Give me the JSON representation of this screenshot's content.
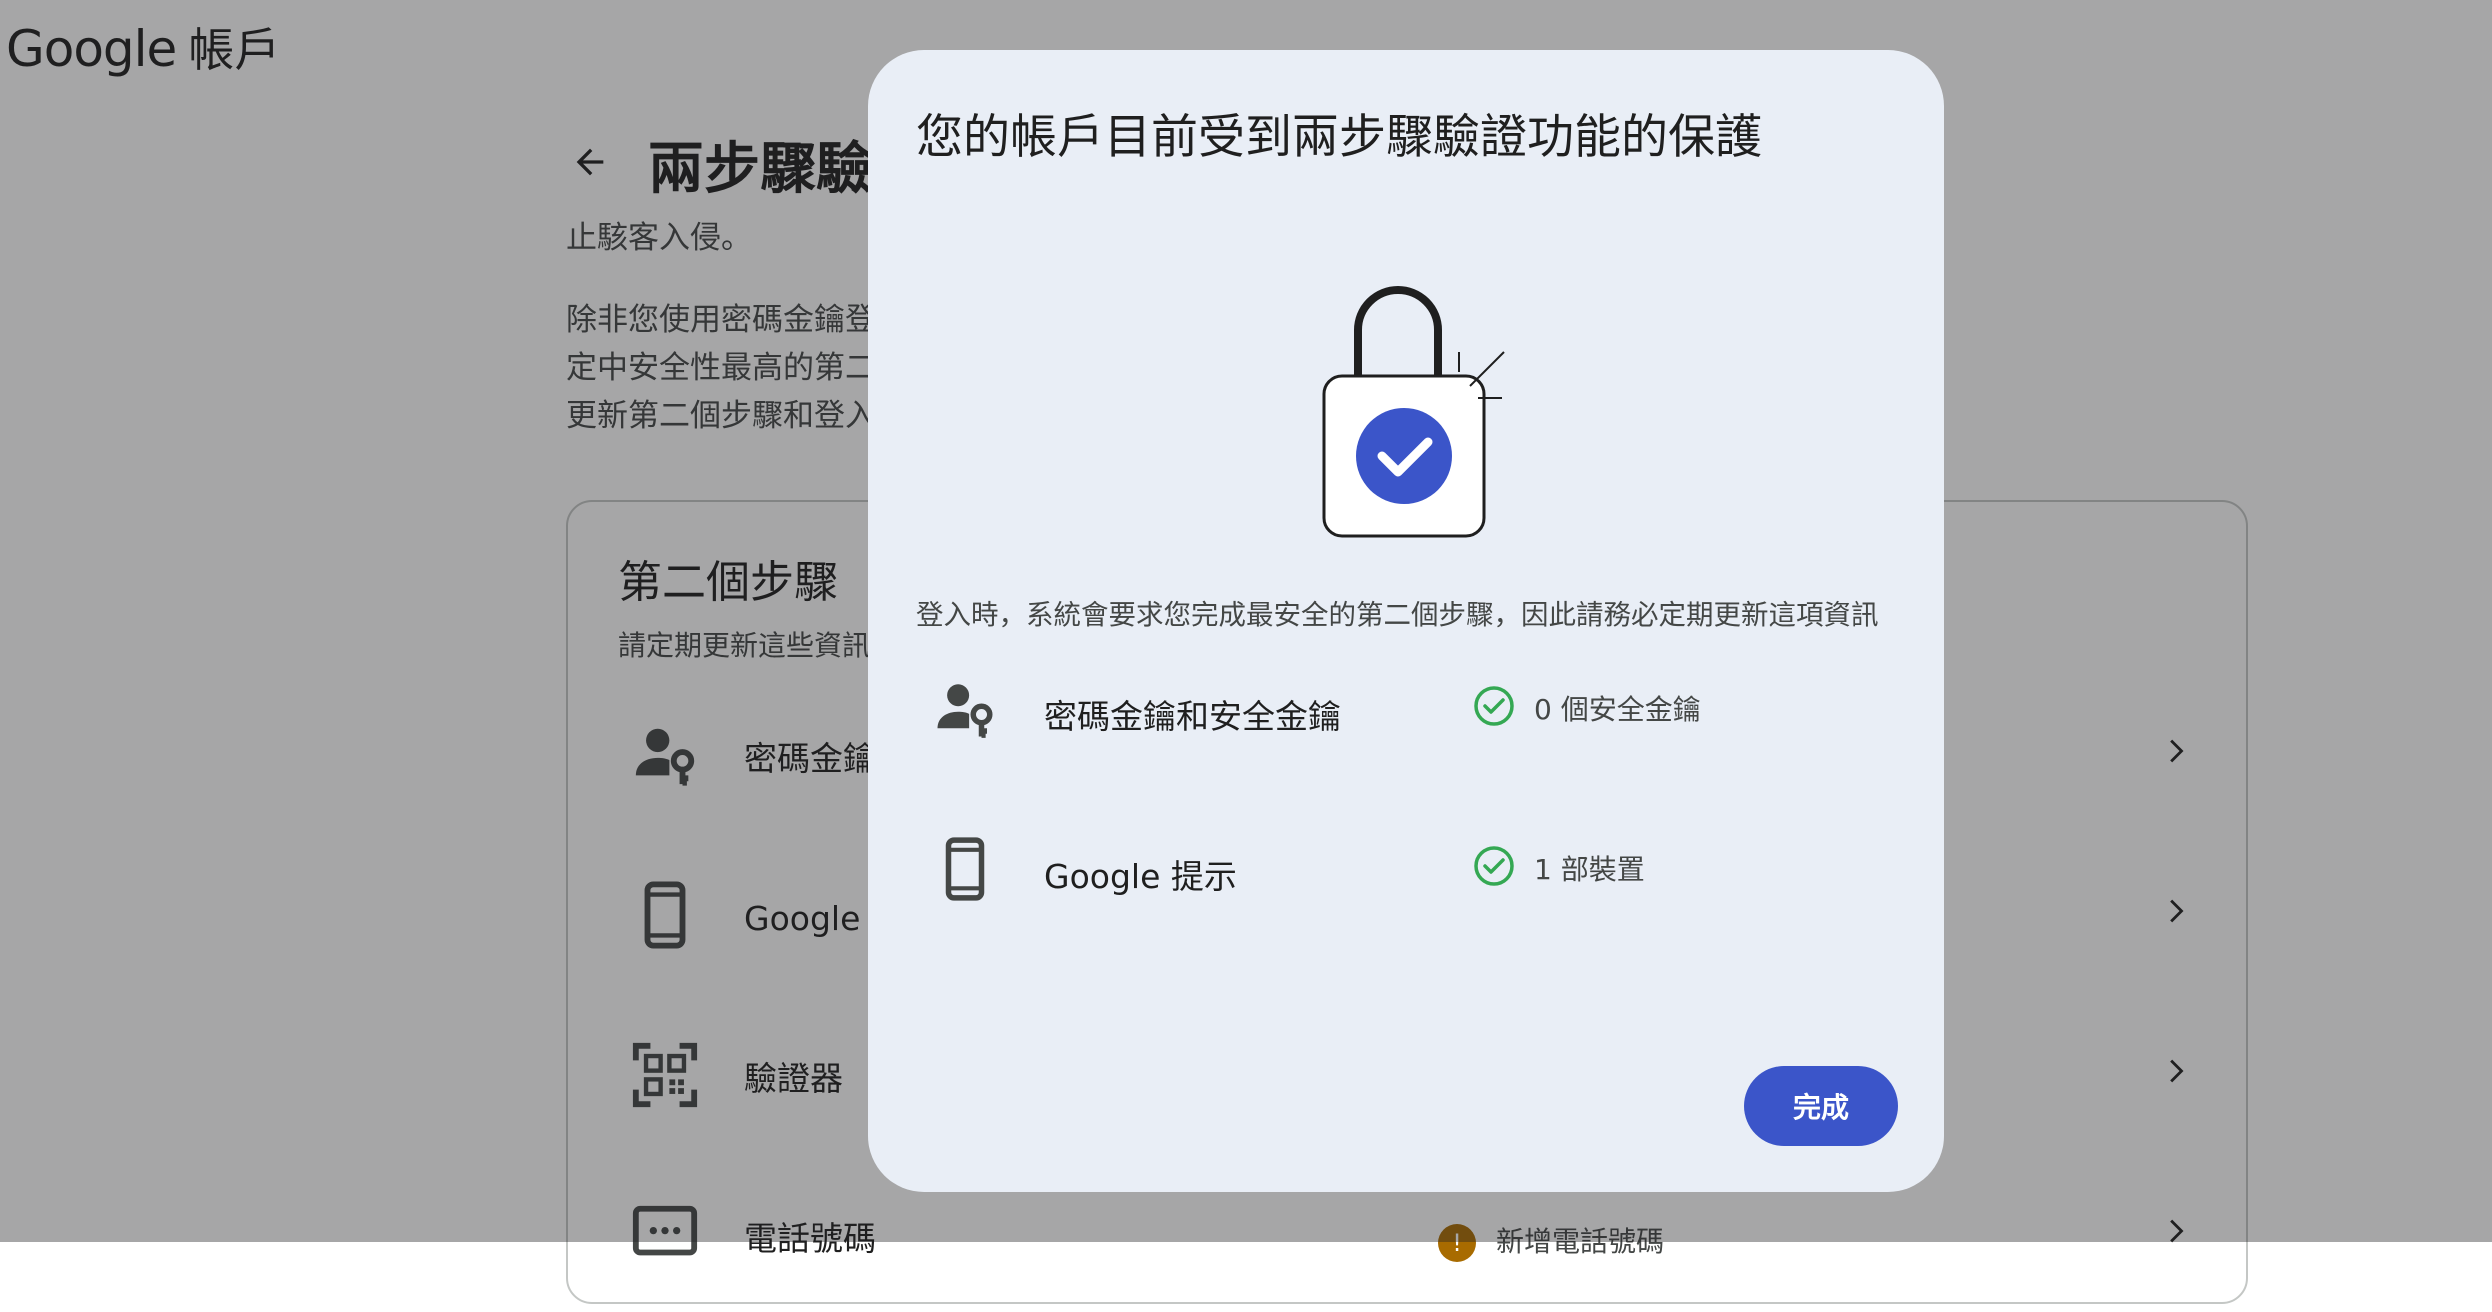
{
  "brand": {
    "google": "Google",
    "account": "帳戶"
  },
  "page": {
    "title": "兩步驟驗",
    "intro_lines": [
      "止駭客入侵。",
      "除非您使用密碼金鑰登",
      "定中安全性最高的第二",
      "更新第二個步驟和登入"
    ]
  },
  "card": {
    "title": "第二個步驟",
    "subtitle": "請定期更新這些資訊",
    "rows": [
      {
        "label": "密碼金鑰",
        "icon": "person-key-icon"
      },
      {
        "label": "Google 提",
        "icon": "phone-icon"
      },
      {
        "label": "驗證器",
        "icon": "qr-code-icon"
      },
      {
        "label": "電話號碼",
        "icon": "message-icon",
        "status": "新增電話號碼",
        "status_icon": "warning-icon"
      }
    ]
  },
  "dialog": {
    "title": "您的帳戶目前受到兩步驟驗證功能的保護",
    "description": "登入時，系統會要求您完成最安全的第二個步驟，因此請務必定期更新這項資訊",
    "items": [
      {
        "label": "密碼金鑰和安全金鑰",
        "status": "0 個安全金鑰",
        "icon": "person-key-icon"
      },
      {
        "label": "Google 提示",
        "status": "1 部裝置",
        "icon": "phone-icon"
      }
    ],
    "done_label": "完成"
  },
  "colors": {
    "accent": "#3b55c9",
    "check": "#34a853",
    "warning": "#a86b00",
    "dialog_bg": "#e9eef6"
  }
}
